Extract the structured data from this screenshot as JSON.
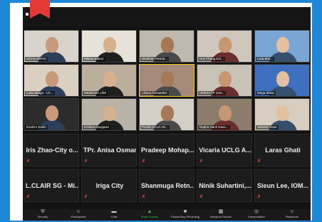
{
  "colors": {
    "accent_green": "#35c759",
    "muted_red": "#e04848",
    "speaker_border": "#f3c91a",
    "banner_red": "#e53935",
    "backdrop_blue": "#1e88d8"
  },
  "video_tiles": [
    {
      "name": "UCLG ASPAC"
    },
    {
      "name": "Mitsuo Saburi"
    },
    {
      "name": "Bhakhan Petrob..."
    },
    {
      "name": "Hon Thung Kel..."
    },
    {
      "name": "Livia Brei..."
    },
    {
      "name": "Luisa Braga - UC..."
    },
    {
      "name": "Madeleine Lillel"
    },
    {
      "name": "Liliana Fernandez"
    },
    {
      "name": "UNESCAP Jore..."
    },
    {
      "name": "Mega Shaw"
    },
    {
      "name": "Ibrahim Saleh"
    },
    {
      "name": "Kristina Naogaret"
    },
    {
      "name": "Pocob UCLG Alt..."
    },
    {
      "name": "Rapha Hanh Kaoc..."
    },
    {
      "name": "Saharim Dars"
    }
  ],
  "name_tiles": [
    {
      "label": "Iris Zhao-City o..."
    },
    {
      "label": "TPr. Anisa Osman"
    },
    {
      "label": "Pradeep Mohap..."
    },
    {
      "label": "Vicaria UCLG A..."
    },
    {
      "label": "Laras Ghati"
    },
    {
      "label": "L.CLAIR SG - Mi..."
    },
    {
      "label": "Iriga City"
    },
    {
      "label": "Shanmuga Retn..."
    },
    {
      "label": "Ninik Suhartini,..."
    },
    {
      "label": "Sieun Lee, IOM..."
    }
  ],
  "toolbar": [
    {
      "label": "Security",
      "icon": "shield-icon"
    },
    {
      "label": "Participants",
      "icon": "participants-icon"
    },
    {
      "label": "Chat",
      "icon": "chat-icon"
    },
    {
      "label": "Share Screen",
      "icon": "share-screen-icon"
    },
    {
      "label": "Pause/Stop Recording",
      "icon": "record-icon"
    },
    {
      "label": "Breakout Rooms",
      "icon": "breakout-icon"
    },
    {
      "label": "Interpretation",
      "icon": "globe-icon"
    },
    {
      "label": "Reactions",
      "icon": "reaction-icon"
    }
  ],
  "muted_glyph": "✗"
}
